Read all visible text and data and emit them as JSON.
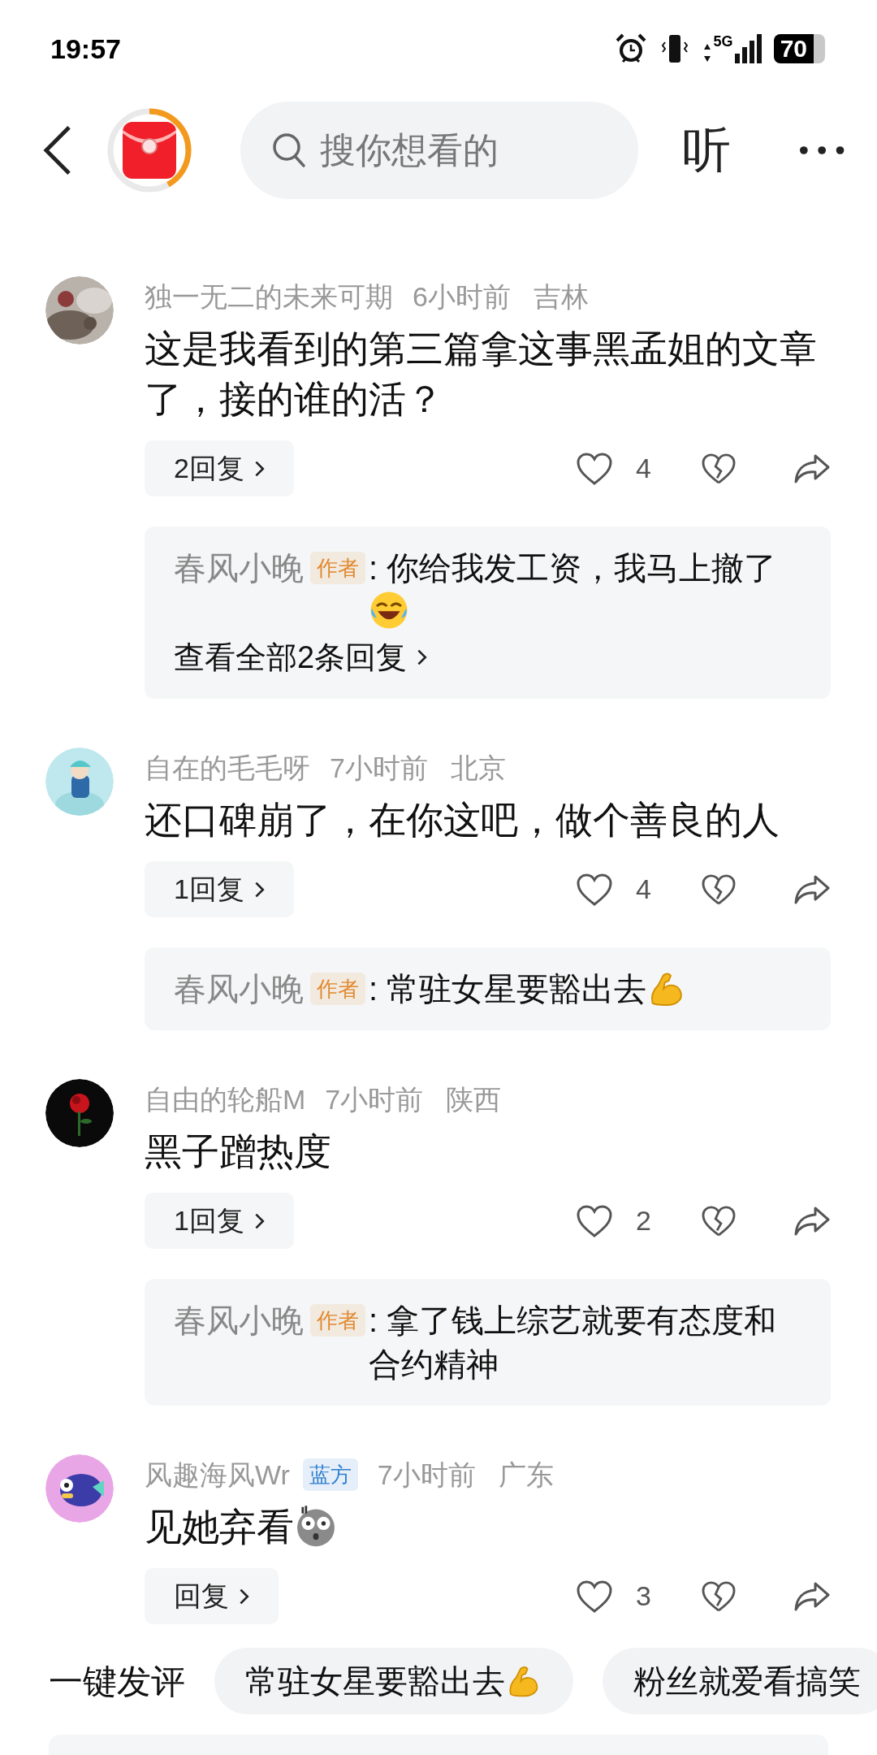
{
  "status_bar": {
    "time": "19:57",
    "network": "5G",
    "battery": "70"
  },
  "nav": {
    "progress": {
      "level": 0.42
    },
    "search_placeholder": "搜你想看的",
    "listen": "听"
  },
  "comments": [
    {
      "user": "独一无二的未来可期",
      "time": "6小时前",
      "location": "吉林",
      "text": "这是我看到的第三篇拿这事黑孟姐的文章了，接的谁的活？",
      "replies_button": "2回复",
      "likes": "4",
      "reply": {
        "user": "春风小晚",
        "tag": {
          "label": "作者",
          "color": "#e0892e"
        },
        "text": ": 你给我发工资，我马上撤了",
        "emoji": {
          "kind": "laugh"
        },
        "more": "查看全部2条回复"
      }
    },
    {
      "user": "自在的毛毛呀",
      "time": "7小时前",
      "location": "北京",
      "text": "还口碑崩了，在你这吧，做个善良的人",
      "replies_button": "1回复",
      "likes": "4",
      "reply": {
        "user": "春风小晚",
        "tag": {
          "label": "作者",
          "color": "#e0892e"
        },
        "text": ": 常驻女星要豁出去",
        "emoji": {
          "kind": "muscle"
        }
      }
    },
    {
      "user": "自由的轮船M",
      "time": "7小时前",
      "location": "陕西",
      "text": "黑子蹭热度",
      "replies_button": "1回复",
      "likes": "2",
      "reply": {
        "user": "春风小晚",
        "tag": {
          "label": "作者",
          "color": "#e0892e"
        },
        "text": ": 拿了钱上综艺就要有态度和合约精神"
      }
    },
    {
      "user": "风趣海风Wr",
      "tag": {
        "label": "蓝方",
        "color": "#2f7fcf"
      },
      "time": "7小时前",
      "location": "广东",
      "text": "见她弃看",
      "emoji": {
        "kind": "shock"
      },
      "replies_button": "回复",
      "likes": "3"
    }
  ],
  "quick_comment": {
    "label": "一键发评",
    "chips": [
      {
        "text": "常驻女星要豁出去",
        "emoji": {
          "kind": "muscle"
        }
      },
      {
        "text": "粉丝就爱看搞笑"
      }
    ]
  }
}
